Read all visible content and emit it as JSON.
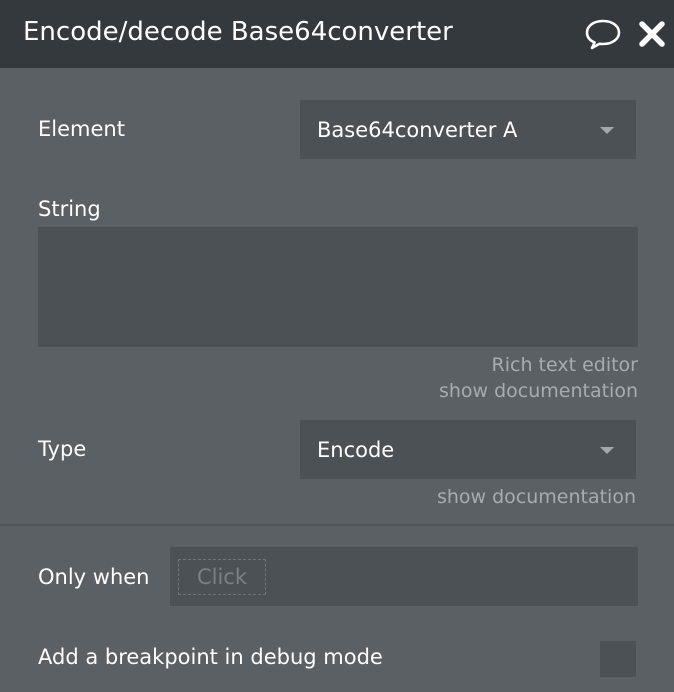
{
  "header": {
    "title": "Encode/decode Base64converter",
    "comment_icon": "speech-bubble-icon",
    "close_icon": "close-icon"
  },
  "element_field": {
    "label": "Element",
    "value": "Base64converter A"
  },
  "string_field": {
    "label": "String",
    "value": "",
    "rich_text_link": "Rich text editor",
    "doc_link": "show documentation"
  },
  "type_field": {
    "label": "Type",
    "value": "Encode",
    "doc_link": "show documentation"
  },
  "condition": {
    "label": "Only when",
    "placeholder_chip": "Click"
  },
  "breakpoint": {
    "label": "Add a breakpoint in debug mode",
    "checked": false
  },
  "colors": {
    "header_bg": "#34393d",
    "panel_bg": "#5b6064",
    "field_bg": "#4c5155",
    "muted_text": "#a7acb0"
  }
}
